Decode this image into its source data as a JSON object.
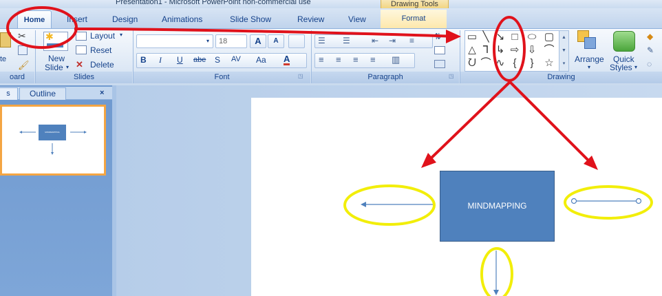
{
  "window": {
    "title": "Presentation1 - Microsoft PowerPoint non-commercial use",
    "context_tab_group": "Drawing Tools"
  },
  "tabs": [
    {
      "label": "Home",
      "active": true
    },
    {
      "label": "Insert"
    },
    {
      "label": "Design"
    },
    {
      "label": "Animations"
    },
    {
      "label": "Slide Show"
    },
    {
      "label": "Review"
    },
    {
      "label": "View"
    },
    {
      "label": "Format"
    }
  ],
  "ribbon": {
    "clipboard": {
      "label": "oard",
      "paste_partial": "te"
    },
    "slides": {
      "label": "Slides",
      "new_slide": "New",
      "new_slide_2": "Slide",
      "layout": "Layout",
      "reset": "Reset",
      "delete": "Delete"
    },
    "font": {
      "label": "Font",
      "size": "18",
      "grow": "A",
      "shrink": "A",
      "bold": "B",
      "italic": "I",
      "underline": "U",
      "strike": "abe",
      "shadow": "S",
      "spacing": "AV",
      "case": "Aa",
      "color": "A"
    },
    "paragraph": {
      "label": "Paragraph"
    },
    "drawing": {
      "label": "Drawing",
      "arrange": "Arrange",
      "quick_styles": "Quick",
      "quick_styles_2": "Styles"
    }
  },
  "left_pane": {
    "tab_slides": "s",
    "tab_outline": "Outline",
    "close": "×"
  },
  "slide": {
    "center_box_text": "MINDMAPPING",
    "thumb_box_text": "MINDMAPPING"
  },
  "colors": {
    "accent_box": "#4f81bd",
    "annotation_red": "#e0121b",
    "annotation_yellow": "#f2ee0a",
    "thumb_border": "#f4a543"
  }
}
